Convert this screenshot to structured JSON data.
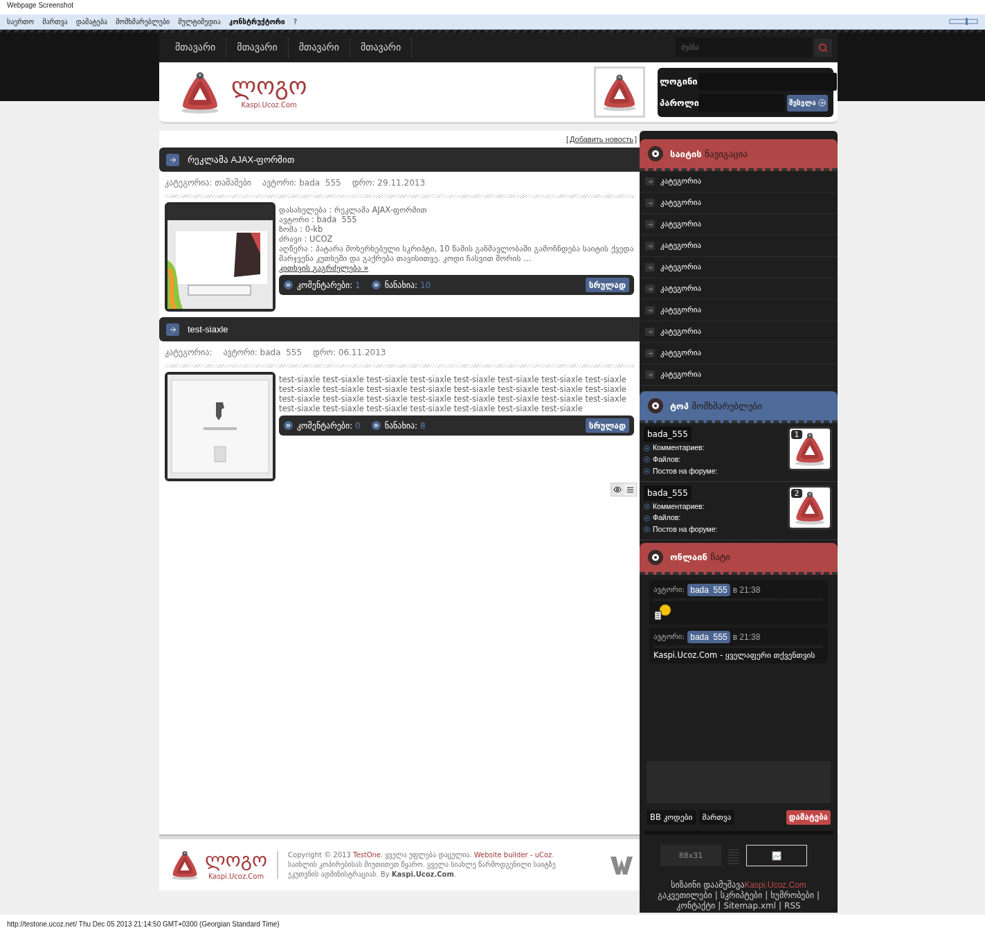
{
  "page_caption": "Webpage Screenshot",
  "admin_bar": {
    "items": [
      {
        "label": "საერთო",
        "selected": false
      },
      {
        "label": "მართვა",
        "selected": false
      },
      {
        "label": "დამატება",
        "selected": false
      },
      {
        "label": "მომხმარებლები",
        "selected": false
      },
      {
        "label": "მულტიმედია",
        "selected": false
      },
      {
        "label": "კონსტრუქტორი",
        "selected": true
      },
      {
        "label": "?",
        "selected": false
      }
    ]
  },
  "nav": {
    "items": [
      "მთავარი",
      "მთავარი",
      "მთავარი",
      "მთავარი"
    ],
    "search": {
      "placeholder": "ძებნა"
    }
  },
  "header": {
    "logo": {
      "text": "ლოგო",
      "subtitle": "Kaspi.Ucoz.Com"
    },
    "login": {
      "login_label": "ლოგინი",
      "password_label": "პაროლი",
      "button": "შესვლა"
    }
  },
  "add_news": {
    "open": "[",
    "link": "Добавить новость",
    "close": "]"
  },
  "posts": [
    {
      "title": "რეკლამა AJAX-ფორმით",
      "meta": [
        "კატეგორია: თამაშები",
        "ავტორი: bada  555",
        "დრო: 29.11.2013"
      ],
      "thumb": {
        "kind": "picture"
      },
      "lines": [
        "დასახელება : რეკლამა AJAX-ფორმით",
        "ავტორი : bada  555",
        "ზომა : 0-kb",
        "ძრავი : UCOZ",
        "აღწერა : პატარა მოხერხებული სკრიპტი, 10 წამის განმავლობაში გამოჩნდება საიტის ქვედა მარჯვენა კუთხეში და გაქრება თავისითვე. კოდი ჩასვით შორის ..."
      ],
      "read_more": "კითხვის გაგრძელება »",
      "comments_label": "კომენტარები:",
      "comments": "1",
      "views_label": "ნანახია:",
      "views": "10",
      "full_button": "სრულად"
    },
    {
      "title": "test-siaxle",
      "meta": [
        "კატეგორია:",
        "ავტორი: bada  555",
        "დრო: 06.11.2013"
      ],
      "thumb": {
        "kind": "picture"
      },
      "lines": [
        "test-siaxle test-siaxle test-siaxle test-siaxle test-siaxle test-siaxle test-siaxle test-siaxle test-siaxle test-siaxle test-siaxle test-siaxle test-siaxle test-siaxle test-siaxle test-siaxle test-siaxle test-siaxle test-siaxle test-siaxle test-siaxle test-siaxle test-siaxle test-siaxle test-siaxle test-siaxle test-siaxle test-siaxle test-siaxle test-siaxle test-siaxle"
      ],
      "comments_label": "კომენტარები:",
      "comments": "0",
      "views_label": "ნანახია:",
      "views": "8",
      "full_button": "სრულად"
    }
  ],
  "sidebar": {
    "navigation": {
      "title": "საიტის",
      "title_rest": "ნავიგაცია",
      "color": "#b04646",
      "items": [
        "კატეგორია",
        "კატეგორია",
        "კატეგორია",
        "კატეგორია",
        "კატეგორია",
        "კატეგორია",
        "კატეგორია",
        "კატეგორია",
        "კატეგორია",
        "კატეგორია"
      ]
    },
    "top_users": {
      "title": "ტოპ",
      "title_rest": "მომხმარებლები",
      "color": "#4e6b9a",
      "users": [
        {
          "name": "bada_555",
          "rank": "1",
          "stats": [
            "Комментариев:",
            "Файлов:",
            "Постов на форуме:"
          ]
        },
        {
          "name": "bada_555",
          "rank": "2",
          "stats": [
            "Комментариев:",
            "Файлов:",
            "Постов на форуме:"
          ]
        }
      ]
    },
    "chat": {
      "title": "ონლაინ",
      "title_rest": "ჩატი",
      "color": "#b04646",
      "messages": [
        {
          "kind": "emoticon",
          "author_label": "ავტორი:",
          "author": "bada  555",
          "time": "в 21:38"
        },
        {
          "kind": "text",
          "author_label": "ავტორი:",
          "author": "bada  555",
          "time": "в 21:38",
          "text": "Kaspi.Ucoz.Com - ყველაფერი თქვენთვის"
        }
      ],
      "buttons": [
        "BB კოდები",
        "მართვა"
      ],
      "send_button": "დამატება"
    },
    "counter": "88x31",
    "credit": {
      "text": "სიზაინი დაამუშავა",
      "link": "Kaspi.Ucoz.Com"
    },
    "links": [
      "გაკვეთილები",
      "სკრიპტები",
      "ხუმრობები",
      "კონტაქტი",
      "Sitemap.xml",
      "RSS"
    ],
    "link_separator": "|"
  },
  "footer": {
    "logo": {
      "text": "ლოგო",
      "subtitle": "Kaspi.Ucoz.Com"
    },
    "copyright": [
      {
        "kind": "plain",
        "text": "Copyright © 2013 "
      },
      {
        "kind": "link",
        "text": "TestOne"
      },
      {
        "kind": "plain",
        "text": ". ყველა უფლება დაცულია. "
      },
      {
        "kind": "link",
        "text": "Website builder - uCoz"
      },
      {
        "kind": "plain",
        "text": ". საიხლის კოპირებისას მიუთითეთ წყარო. ყველა სიახლე წარმოდგენილი საიტზე ეკუთვნის ადმინისტრაციას. By "
      },
      {
        "kind": "bold",
        "text": "Kaspi.Ucoz.Com"
      },
      {
        "kind": "plain",
        "text": "."
      }
    ]
  },
  "status_bar": "http://testone.ucoz.net/ Thu Dec 05 2013 21:14:50 GMT+0300 (Georgian Standard Time)"
}
